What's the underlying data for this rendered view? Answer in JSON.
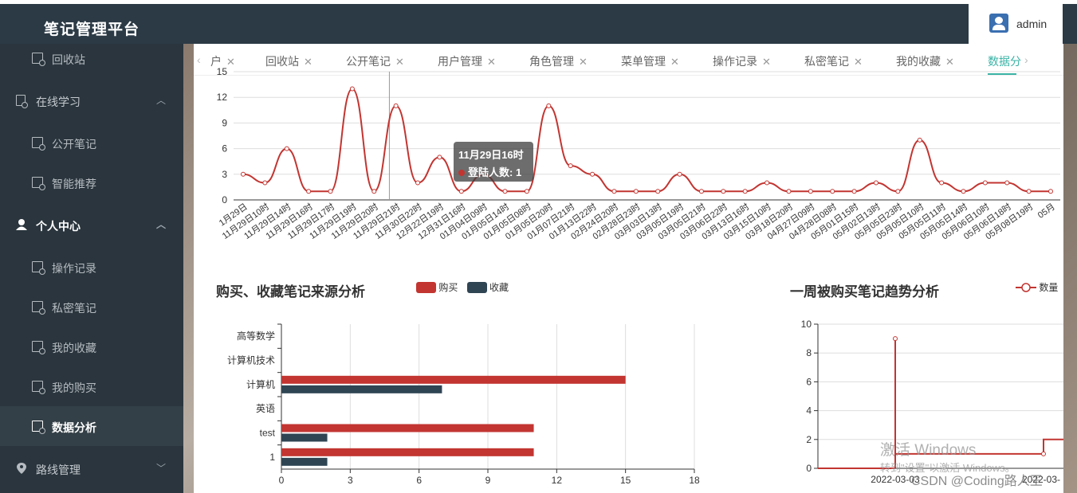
{
  "header": {
    "title": "笔记管理平台",
    "username": "admin"
  },
  "sidebar": {
    "items": [
      {
        "label": "回收站",
        "icon": "doc-settings-icon",
        "level": "child"
      },
      {
        "label": "在线学习",
        "icon": "doc-icon",
        "level": "parent"
      },
      {
        "label": "公开笔记",
        "icon": "doc-settings-icon",
        "level": "child"
      },
      {
        "label": "智能推荐",
        "icon": "doc-settings-icon",
        "level": "child"
      },
      {
        "label": "个人中心",
        "icon": "user-icon",
        "level": "parent"
      },
      {
        "label": "操作记录",
        "icon": "doc-settings-icon",
        "level": "child"
      },
      {
        "label": "私密笔记",
        "icon": "doc-settings-icon",
        "level": "child"
      },
      {
        "label": "我的收藏",
        "icon": "doc-settings-icon",
        "level": "child"
      },
      {
        "label": "我的购买",
        "icon": "doc-settings-icon",
        "level": "child"
      },
      {
        "label": "数据分析",
        "icon": "doc-settings-icon",
        "level": "child"
      },
      {
        "label": "路线管理",
        "icon": "location-icon",
        "level": "parent"
      }
    ]
  },
  "tabs": [
    {
      "label": "户"
    },
    {
      "label": "回收站"
    },
    {
      "label": "公开笔记"
    },
    {
      "label": "用户管理"
    },
    {
      "label": "角色管理"
    },
    {
      "label": "菜单管理"
    },
    {
      "label": "操作记录"
    },
    {
      "label": "私密笔记"
    },
    {
      "label": "我的收藏"
    },
    {
      "label": "数据分"
    }
  ],
  "tooltip": {
    "title": "11月29日16时",
    "series": "登陆人数",
    "value": "1"
  },
  "chart_data": [
    {
      "type": "line",
      "series": [
        {
          "name": "登陆人数",
          "values": [
            3,
            2,
            6,
            1,
            1,
            13,
            1,
            11,
            2,
            5,
            1,
            3,
            1,
            1,
            11,
            4,
            3,
            1,
            1,
            1,
            3,
            1,
            1,
            1,
            2,
            1,
            1,
            1,
            1,
            2,
            1,
            7,
            2,
            1,
            2,
            2,
            1,
            1
          ]
        }
      ],
      "categories": [
        "1月29日",
        "11月29日10时",
        "11月29日14时",
        "11月29日16时",
        "11月29日17时",
        "11月29日19时",
        "11月29日20时",
        "11月29日21时",
        "11月30日22时",
        "12月22日19时",
        "12月31日16时",
        "01月04日09时",
        "01月05日14时",
        "01月05日08时",
        "01月05日20时",
        "01月07日21时",
        "01月13日22时",
        "02月24日20时",
        "02月28日23时",
        "03月03日13时",
        "03月05日19时",
        "03月05日21时",
        "03月06日22时",
        "03月13日16时",
        "03月15日10时",
        "03月18日20时",
        "04月27日09时",
        "04月28日08时",
        "05月01日15时",
        "05月02日13时",
        "05月05日23时",
        "05月05日10时",
        "05月05日11时",
        "05月05日14时",
        "05月06日10时",
        "05月06日18时",
        "05月08日19时",
        "05月"
      ],
      "ylim": [
        0,
        15
      ],
      "yticks": [
        0,
        3,
        6,
        9,
        12,
        15
      ],
      "grid": true
    },
    {
      "type": "bar",
      "orientation": "horizontal",
      "title": "购买、收藏笔记来源分析",
      "categories": [
        "1",
        "test",
        "英语",
        "计算机",
        "计算机技术",
        "高等数学"
      ],
      "series": [
        {
          "name": "购买",
          "values": [
            11,
            11,
            0,
            15,
            0,
            0
          ],
          "color": "#c23531"
        },
        {
          "name": "收藏",
          "values": [
            2,
            2,
            0,
            7,
            0,
            0
          ],
          "color": "#2f4554"
        }
      ],
      "xlim": [
        0,
        18
      ],
      "xticks": [
        0,
        3,
        6,
        9,
        12,
        15,
        18
      ],
      "legend": "top"
    },
    {
      "type": "line",
      "title": "一周被购买笔记趋势分析",
      "series": [
        {
          "name": "数量",
          "values": [
            0,
            9,
            1,
            1,
            2
          ],
          "color": "#c23531"
        }
      ],
      "xticklabels": [
        "2022-03-03",
        "2022-03-"
      ],
      "ylim": [
        0,
        10
      ],
      "yticks": [
        0,
        2,
        4,
        6,
        8,
        10
      ],
      "legend": "top-right"
    }
  ],
  "watermark": {
    "line1": "激活 Windows",
    "line2": "转到\"设置\"以激活 Windows。",
    "credit": "CSDN @Coding路人王"
  }
}
